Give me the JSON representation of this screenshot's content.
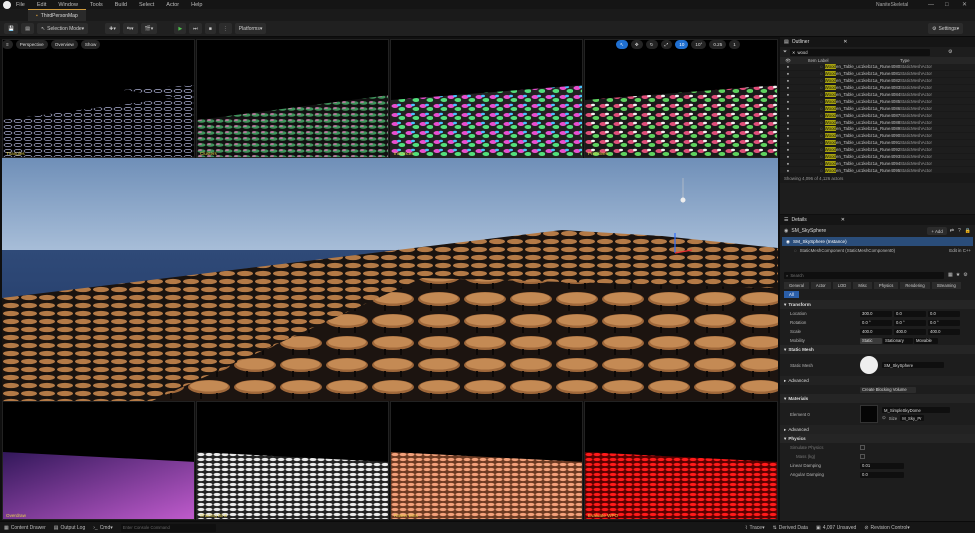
{
  "menu": [
    "File",
    "Edit",
    "Window",
    "Tools",
    "Build",
    "Select",
    "Actor",
    "Help"
  ],
  "window_title": "NaniteSkeletal",
  "tab_title": "ThirdPersonMap",
  "toolbar": {
    "selection_mode": "Selection Mode",
    "platforms": "Platforms",
    "settings": "Settings"
  },
  "viewport": {
    "perspective": "Perspective",
    "overview": "Overview",
    "show": "Show",
    "stats": [
      "10",
      "10°",
      "0.25",
      "1"
    ]
  },
  "thumbnails_top": [
    "Triangles",
    "Clusters",
    "Instances",
    "Primitives"
  ],
  "thumbnails_bottom": [
    "Overdraw",
    "Shading Bins",
    "Raster Bins",
    "Evaluate WPO"
  ],
  "outliner": {
    "title": "Outliner",
    "search": "wood",
    "col_label": "Item Label",
    "col_type": "Type",
    "highlight": "Wood",
    "rows": [
      {
        "pre": "Wood",
        "rest": "en_Table_uc1kebz1a_Rune4080",
        "type": "StaticMeshActor"
      },
      {
        "pre": "Wood",
        "rest": "en_Table_uc1kebz1a_Rune4081",
        "type": "StaticMeshActor"
      },
      {
        "pre": "Wood",
        "rest": "en_Table_uc1kebz1a_Rune4082",
        "type": "StaticMeshActor"
      },
      {
        "pre": "Wood",
        "rest": "en_Table_uc1kebz1a_Rune4083",
        "type": "StaticMeshActor"
      },
      {
        "pre": "Wood",
        "rest": "en_Table_uc1kebz1a_Rune4084",
        "type": "StaticMeshActor"
      },
      {
        "pre": "Wood",
        "rest": "en_Table_uc1kebz1a_Rune4085",
        "type": "StaticMeshActor"
      },
      {
        "pre": "Wood",
        "rest": "en_Table_uc1kebz1a_Rune4086",
        "type": "StaticMeshActor"
      },
      {
        "pre": "Wood",
        "rest": "en_Table_uc1kebz1a_Rune4087",
        "type": "StaticMeshActor"
      },
      {
        "pre": "Wood",
        "rest": "en_Table_uc1kebz1a_Rune4088",
        "type": "StaticMeshActor"
      },
      {
        "pre": "Wood",
        "rest": "en_Table_uc1kebz1a_Rune4089",
        "type": "StaticMeshActor"
      },
      {
        "pre": "Wood",
        "rest": "en_Table_uc1kebz1a_Rune4090",
        "type": "StaticMeshActor"
      },
      {
        "pre": "Wood",
        "rest": "en_Table_uc1kebz1a_Rune4091",
        "type": "StaticMeshActor"
      },
      {
        "pre": "Wood",
        "rest": "en_Table_uc1kebz1a_Rune4092",
        "type": "StaticMeshActor"
      },
      {
        "pre": "Wood",
        "rest": "en_Table_uc1kebz1a_Rune4093",
        "type": "StaticMeshActor"
      },
      {
        "pre": "Wood",
        "rest": "en_Table_uc1kebz1a_Rune4094",
        "type": "StaticMeshActor"
      },
      {
        "pre": "Wood",
        "rest": "en_Table_uc1kebz1a_Rune4095",
        "type": "StaticMeshActor"
      }
    ],
    "footer": "Showing 4,096 of 4,126 actors"
  },
  "details": {
    "title": "Details",
    "actor": "SM_SkySphere",
    "add": "+ Add",
    "instance": "SM_SkySphere (Instance)",
    "component": "StaticMeshComponent (StaticMeshComponent0)",
    "edit_cpp": "Edit in C++",
    "search": "Search",
    "cats": [
      "General",
      "Actor",
      "LOD",
      "Misc",
      "Physics",
      "Rendering",
      "Streaming",
      "All"
    ],
    "transform": "Transform",
    "location": "Location",
    "rotation": "Rotation",
    "scale": "Scale",
    "loc": [
      "300.0",
      "0.0",
      "0.0"
    ],
    "rot": [
      "0.0 °",
      "0.0 °",
      "0.0 °"
    ],
    "scl": [
      "400.0",
      "400.0",
      "400.0"
    ],
    "mobility": "Mobility",
    "mob": [
      "Static",
      "Stationary",
      "Movable"
    ],
    "static_mesh_sec": "Static Mesh",
    "static_mesh": "Static Mesh",
    "static_mesh_val": "SM_SkySphere",
    "advanced": "Advanced",
    "create_btn": "Create Blocking Volume",
    "materials": "Materials",
    "element0": "Element 0",
    "mat_val": "M_SimpleSkyDome",
    "size": "Size",
    "mat_short": "M_Sky_Pr",
    "physics": "Physics",
    "simulate": "Simulate Physics",
    "mass": "Mass (kg)",
    "linear": "Linear Damping",
    "angular": "Angular Damping",
    "linear_val": "0.01",
    "angular_val": "0.0"
  },
  "status": {
    "content": "Content Drawer",
    "output": "Output Log",
    "cmd": "Cmd",
    "console": "Enter Console Command",
    "trace": "Trace",
    "derived": "Derived Data",
    "unsaved": "4,097 Unsaved",
    "revision": "Revision Control"
  }
}
